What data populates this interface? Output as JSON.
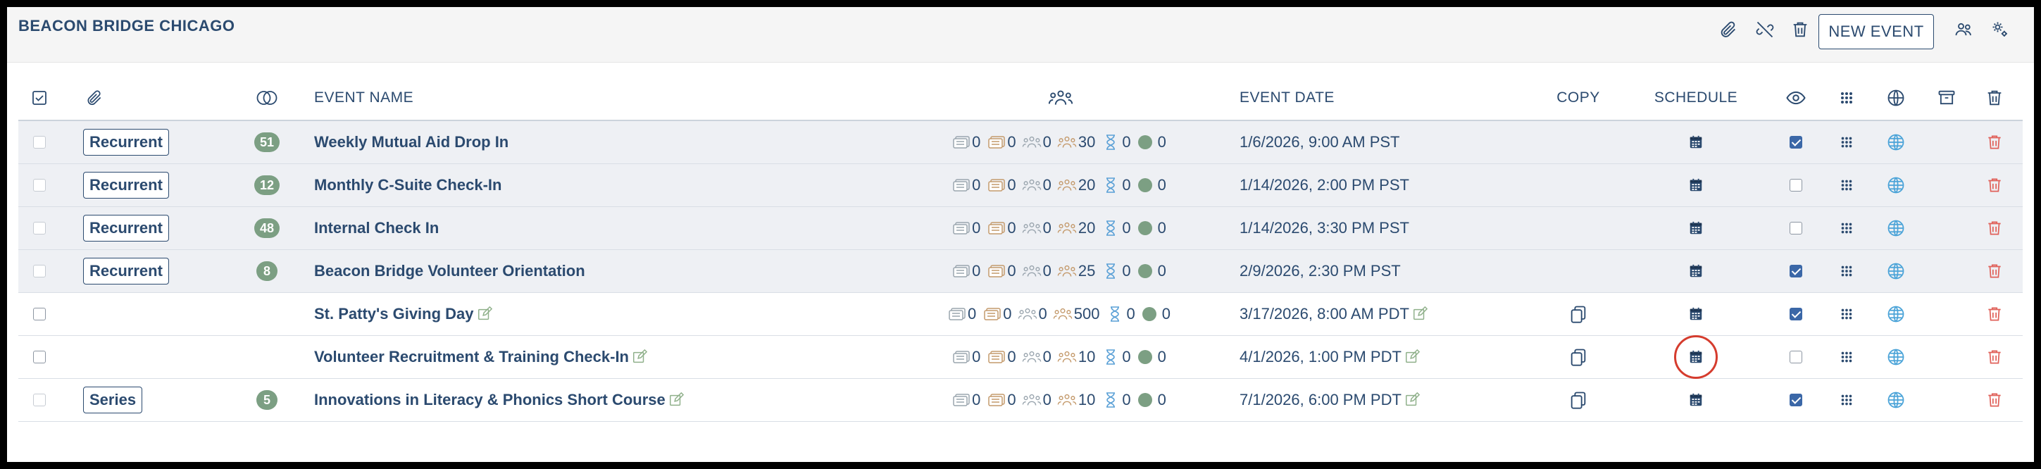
{
  "header": {
    "org_name": "BEACON BRIDGE CHICAGO",
    "new_event_label": "NEW EVENT",
    "icons": [
      "paperclip-icon",
      "unlink-icon",
      "trash-icon",
      "users-icon",
      "settings-icon"
    ]
  },
  "columns": {
    "event_name": "EVENT NAME",
    "event_date": "EVENT DATE",
    "copy": "COPY",
    "schedule": "SCHEDULE"
  },
  "colors": {
    "primary": "#2b4a6f",
    "pill_green": "#7c9f83",
    "delete_red": "#e0615a",
    "globe_blue": "#4aa3d8",
    "group_row_bg": "#eef0f4",
    "highlight_red": "#d53c2e"
  },
  "rows": [
    {
      "type_label": "Recurrent",
      "count": "51",
      "name": "Weekly Mutual Aid Drop In",
      "stats": [
        "0",
        "0",
        "0",
        "30",
        "0",
        "0"
      ],
      "date": "1/6/2026, 9:00 AM PST",
      "visible": true,
      "group": true,
      "editable": false,
      "copy": false
    },
    {
      "type_label": "Recurrent",
      "count": "12",
      "name": "Monthly C-Suite Check-In",
      "stats": [
        "0",
        "0",
        "0",
        "20",
        "0",
        "0"
      ],
      "date": "1/14/2026, 2:00 PM PST",
      "visible": false,
      "group": true,
      "editable": false,
      "copy": false
    },
    {
      "type_label": "Recurrent",
      "count": "48",
      "name": "Internal Check In",
      "stats": [
        "0",
        "0",
        "0",
        "20",
        "0",
        "0"
      ],
      "date": "1/14/2026, 3:30 PM PST",
      "visible": false,
      "group": true,
      "editable": false,
      "copy": false
    },
    {
      "type_label": "Recurrent",
      "count": "8",
      "name": "Beacon Bridge Volunteer Orientation",
      "stats": [
        "0",
        "0",
        "0",
        "25",
        "0",
        "0"
      ],
      "date": "2/9/2026, 2:30 PM PST",
      "visible": true,
      "group": true,
      "editable": false,
      "copy": false
    },
    {
      "type_label": "",
      "count": "",
      "name": "St. Patty's Giving Day",
      "stats": [
        "0",
        "0",
        "0",
        "500",
        "0",
        "0"
      ],
      "date": "3/17/2026, 8:00 AM PDT",
      "visible": true,
      "group": false,
      "editable": true,
      "copy": true
    },
    {
      "type_label": "",
      "count": "",
      "name": "Volunteer Recruitment & Training Check-In",
      "stats": [
        "0",
        "0",
        "0",
        "10",
        "0",
        "0"
      ],
      "date": "4/1/2026, 1:00 PM PDT",
      "visible": false,
      "group": false,
      "editable": true,
      "copy": true,
      "schedule_highlighted": true
    },
    {
      "type_label": "Series",
      "count": "5",
      "name": "Innovations in Literacy & Phonics Short Course",
      "stats": [
        "0",
        "0",
        "0",
        "10",
        "0",
        "0"
      ],
      "date": "7/1/2026, 6:00 PM PDT",
      "visible": true,
      "group": false,
      "editable": true,
      "copy": true
    }
  ]
}
